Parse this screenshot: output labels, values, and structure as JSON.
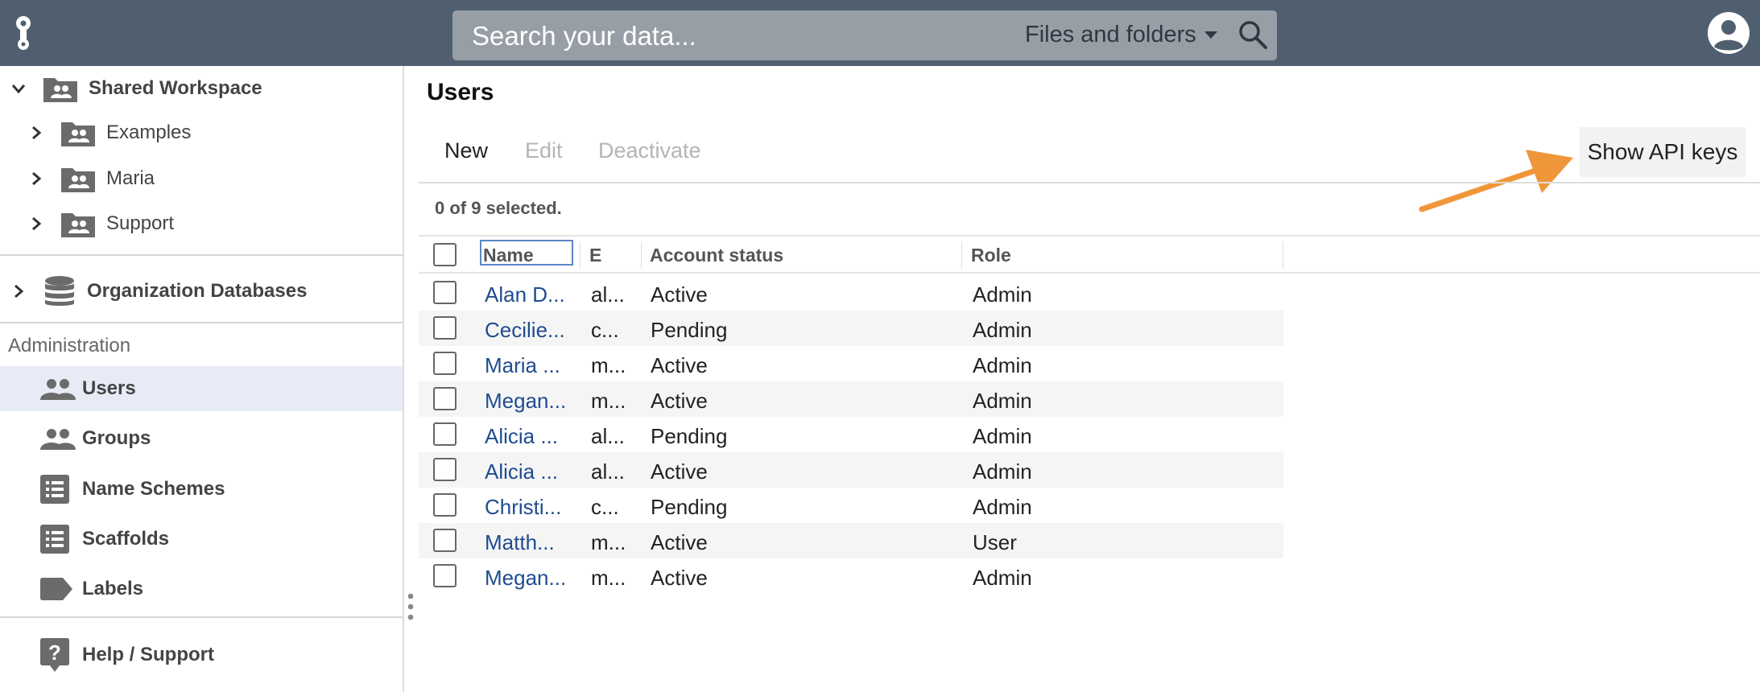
{
  "topbar": {
    "search_placeholder": "Search your data...",
    "search_scope": "Files and folders"
  },
  "sidebar": {
    "workspace": {
      "label": "Shared Workspace",
      "children": [
        {
          "label": "Examples"
        },
        {
          "label": "Maria"
        },
        {
          "label": "Support"
        }
      ]
    },
    "databases_label": "Organization Databases",
    "admin_section": "Administration",
    "admin_items": [
      {
        "label": "Users",
        "icon": "users-icon",
        "active": true
      },
      {
        "label": "Groups",
        "icon": "users-icon",
        "active": false
      },
      {
        "label": "Name Schemes",
        "icon": "list-icon",
        "active": false
      },
      {
        "label": "Scaffolds",
        "icon": "list-icon",
        "active": false
      },
      {
        "label": "Labels",
        "icon": "label-icon",
        "active": false
      }
    ],
    "help_label": "Help / Support"
  },
  "main": {
    "title": "Users",
    "toolbar": {
      "new_label": "New",
      "edit_label": "Edit",
      "deactivate_label": "Deactivate",
      "api_keys_label": "Show API keys"
    },
    "selection_text": "0 of 9 selected.",
    "columns": [
      "Name",
      "E",
      "Account status",
      "Role"
    ],
    "rows": [
      {
        "name": "Alan D...",
        "email": "al...",
        "status": "Active",
        "role": "Admin"
      },
      {
        "name": "Cecilie...",
        "email": "c...",
        "status": "Pending",
        "role": "Admin"
      },
      {
        "name": "Maria ...",
        "email": "m...",
        "status": "Active",
        "role": "Admin"
      },
      {
        "name": "Megan...",
        "email": "m...",
        "status": "Active",
        "role": "Admin"
      },
      {
        "name": "Alicia ...",
        "email": "al...",
        "status": "Pending",
        "role": "Admin"
      },
      {
        "name": "Alicia ...",
        "email": "al...",
        "status": "Active",
        "role": "Admin"
      },
      {
        "name": "Christi...",
        "email": "c...",
        "status": "Pending",
        "role": "Admin"
      },
      {
        "name": "Matth...",
        "email": "m...",
        "status": "Active",
        "role": "User"
      },
      {
        "name": "Megan...",
        "email": "m...",
        "status": "Active",
        "role": "Admin"
      }
    ]
  },
  "colors": {
    "topbar": "#505f70",
    "search_bg": "#979ea6",
    "link": "#1f4c8f",
    "active_nav": "#e6ebf6",
    "annotation_arrow": "#f0963a"
  }
}
